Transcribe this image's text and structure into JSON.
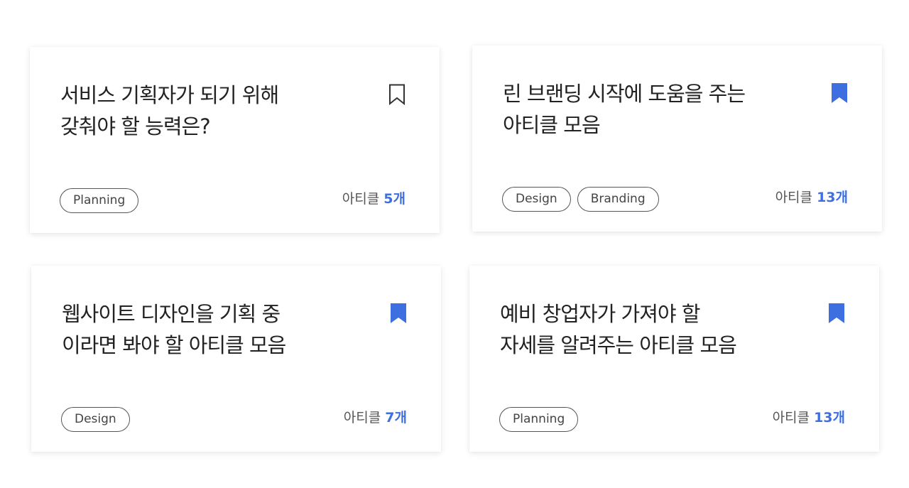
{
  "colors": {
    "accent": "#3d6fe0",
    "outline_icon": "#333333"
  },
  "cards": [
    {
      "title_lines": [
        "서비스 기획자가 되기 위해",
        "갖춰야 할 능력은?"
      ],
      "bookmarked": false,
      "bookmark_icon": "bookmark-outline-icon",
      "tags": [
        "Planning"
      ],
      "count_label": "아티클",
      "count_value": "5개"
    },
    {
      "title_lines": [
        "린 브랜딩 시작에 도움을 주는",
        "아티클 모음"
      ],
      "bookmarked": true,
      "bookmark_icon": "bookmark-filled-icon",
      "tags": [
        "Design",
        "Branding"
      ],
      "count_label": "아티클",
      "count_value": "13개"
    },
    {
      "title_lines": [
        "웹사이트 디자인을 기획 중",
        "이라면 봐야 할 아티클 모음"
      ],
      "bookmarked": true,
      "bookmark_icon": "bookmark-filled-icon",
      "tags": [
        "Design"
      ],
      "count_label": "아티클",
      "count_value": "7개"
    },
    {
      "title_lines": [
        "예비 창업자가 가져야 할",
        "자세를 알려주는 아티클 모음"
      ],
      "bookmarked": true,
      "bookmark_icon": "bookmark-filled-icon",
      "tags": [
        "Planning"
      ],
      "count_label": "아티클",
      "count_value": "13개"
    }
  ]
}
